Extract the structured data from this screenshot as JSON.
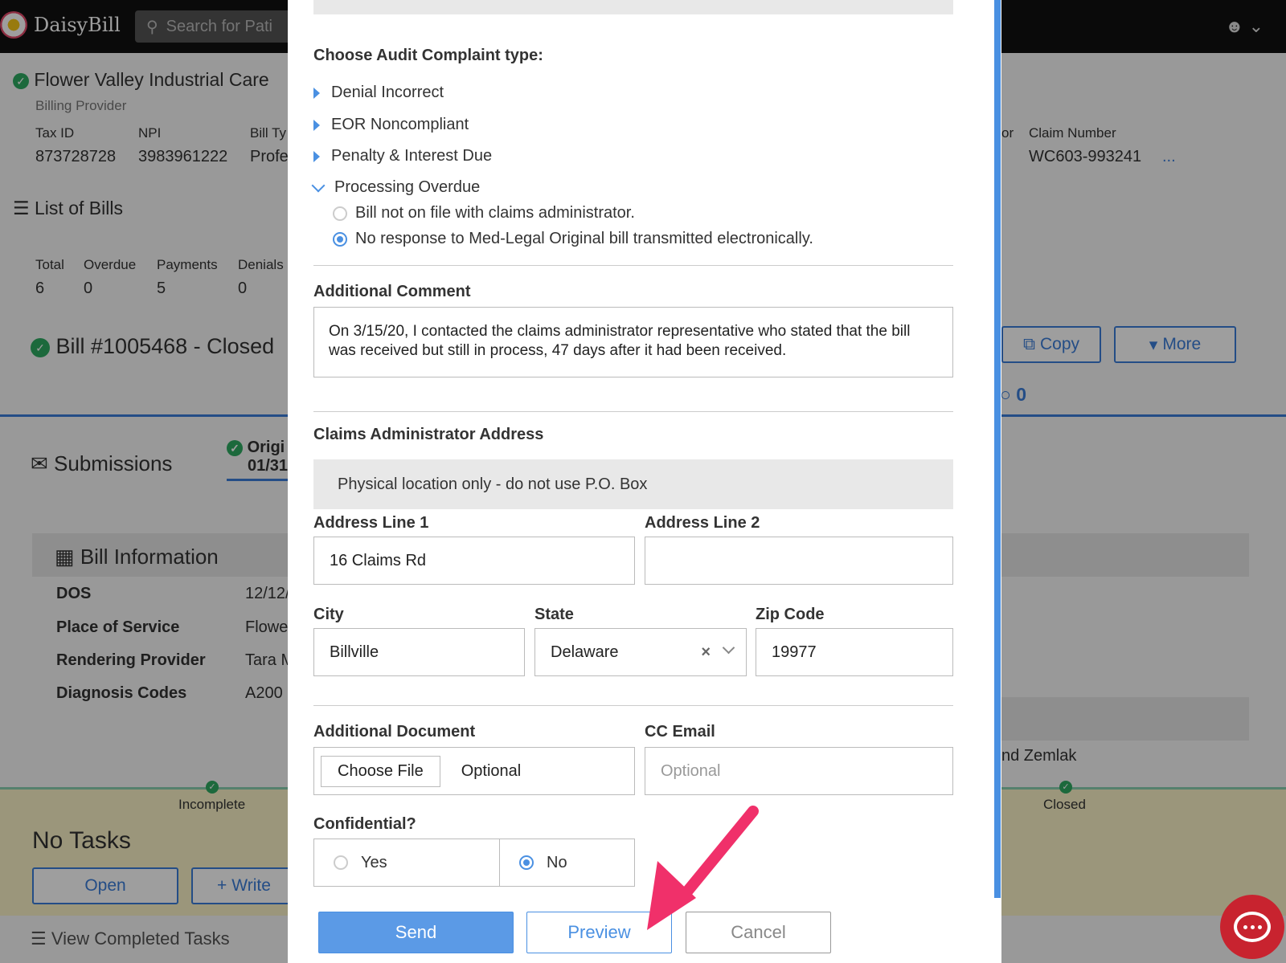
{
  "app": {
    "logo_text": "DaisyBill",
    "search_placeholder": "Search for Pati"
  },
  "provider": {
    "name": "Flower Valley Industrial Care",
    "role": "Billing Provider",
    "fields": [
      {
        "label": "Tax ID",
        "value": "873728728"
      },
      {
        "label": "NPI",
        "value": "3983961222"
      },
      {
        "label": "Bill Ty",
        "value": "Profe"
      }
    ],
    "claim_partial_label": "or",
    "claim_label": "Claim Number",
    "claim_value": "WC603-993241",
    "claim_more": "..."
  },
  "bills": {
    "title": "List of Bills",
    "stats": [
      {
        "label": "Total",
        "value": "6"
      },
      {
        "label": "Overdue",
        "value": "0"
      },
      {
        "label": "Payments",
        "value": "5"
      },
      {
        "label": "Denials",
        "value": "0"
      }
    ]
  },
  "bill": {
    "title": "Bill #1005468 - Closed",
    "copy_label": "Copy",
    "more_label": "More",
    "count": "0",
    "submissions_label": "Submissions",
    "orig_tab_line1": "Origi",
    "orig_tab_line2": "01/31/"
  },
  "bill_info": {
    "title": "Bill Information",
    "rows": [
      {
        "label": "DOS",
        "value": "12/12/"
      },
      {
        "label": "Place of Service",
        "value": "Flowe"
      },
      {
        "label": "Rendering Provider",
        "value": "Tara M"
      },
      {
        "label": "Diagnosis Codes",
        "value": "A200"
      }
    ],
    "right_text": "nd Zemlak"
  },
  "tasks": {
    "incomplete_label": "Incomplete",
    "closed_label": "Closed",
    "no_tasks": "No Tasks",
    "open_label": "Open",
    "write_label": "Write",
    "view_completed": "View Completed Tasks"
  },
  "modal": {
    "complaint_title": "Choose Audit Complaint type:",
    "complaint_types": [
      "Denial Incorrect",
      "EOR Noncompliant",
      "Penalty & Interest Due"
    ],
    "expanded_type": "Processing Overdue",
    "options": [
      {
        "label": "Bill not on file with claims administrator.",
        "selected": false
      },
      {
        "label": "No response to Med-Legal Original bill transmitted electronically.",
        "selected": true
      }
    ],
    "comment_label": "Additional Comment",
    "comment_value": "On 3/15/20, I contacted the claims administrator representative who stated that the bill was received but still in process, 47 days after it had been received.",
    "address_title": "Claims Administrator Address",
    "address_note": "Physical location only - do not use P.O. Box",
    "address1_label": "Address Line 1",
    "address1_value": "16 Claims Rd",
    "address2_label": "Address Line 2",
    "address2_value": "",
    "city_label": "City",
    "city_value": "Billville",
    "state_label": "State",
    "state_value": "Delaware",
    "state_clear": "×",
    "zip_label": "Zip Code",
    "zip_value": "19977",
    "doc_label": "Additional Document",
    "choose_file": "Choose File",
    "doc_optional": "Optional",
    "cc_label": "CC Email",
    "cc_placeholder": "Optional",
    "confidential_label": "Confidential?",
    "yes_label": "Yes",
    "no_label": "No",
    "confidential_selected": "No",
    "send_label": "Send",
    "preview_label": "Preview",
    "cancel_label": "Cancel"
  },
  "colors": {
    "accent": "#4a90e2",
    "success": "#2eaa62",
    "arrow": "#f0306a",
    "chat": "#c8232f"
  }
}
